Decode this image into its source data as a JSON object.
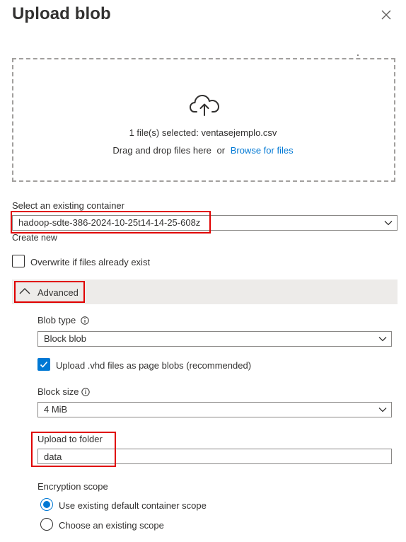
{
  "panel": {
    "title": "Upload blob"
  },
  "dropzone": {
    "selected_text": "1 file(s) selected: ventasejemplo.csv",
    "drag_text": "Drag and drop files here",
    "or_text": "or",
    "browse_link": "Browse for files"
  },
  "container": {
    "label": "Select an existing container",
    "selected": "hadoop-sdte-386-2024-10-25t14-14-25-608z",
    "create_new": "Create new"
  },
  "overwrite": {
    "label": "Overwrite if files already exist",
    "checked": false
  },
  "advanced": {
    "label": "Advanced",
    "expanded": true,
    "blob_type": {
      "label": "Blob type",
      "selected": "Block blob"
    },
    "vhd_checkbox": {
      "label": "Upload .vhd files as page blobs (recommended)",
      "checked": true
    },
    "block_size": {
      "label": "Block size",
      "selected": "4 MiB"
    },
    "upload_folder": {
      "label": "Upload to folder",
      "value": "data"
    },
    "encryption": {
      "label": "Encryption scope",
      "options": [
        {
          "label": "Use existing default container scope",
          "selected": true
        },
        {
          "label": "Choose an existing scope",
          "selected": false
        }
      ]
    }
  },
  "colors": {
    "accent": "#0078d4",
    "highlight": "#e00000",
    "section_bg": "#edebe9"
  }
}
